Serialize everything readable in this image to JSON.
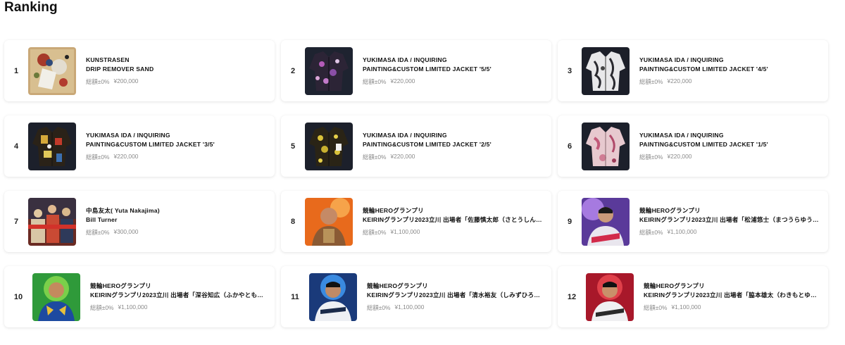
{
  "page": {
    "title": "Ranking"
  },
  "ranking": [
    {
      "rank": "1",
      "artist": "KUNSTRASEN",
      "name": "DRIP REMOVER SAND",
      "change": "総額±0%",
      "price": "¥200,000",
      "thumb": "painting-icon"
    },
    {
      "rank": "2",
      "artist": "YUKIMASA IDA / INQUIRING",
      "name": "PAINTING&CUSTOM LIMITED JACKET '5/5'",
      "change": "総額±0%",
      "price": "¥220,000",
      "thumb": "jacket-icon"
    },
    {
      "rank": "3",
      "artist": "YUKIMASA IDA / INQUIRING",
      "name": "PAINTING&CUSTOM LIMITED JACKET '4/5'",
      "change": "総額±0%",
      "price": "¥220,000",
      "thumb": "jacket-icon"
    },
    {
      "rank": "4",
      "artist": "YUKIMASA IDA / INQUIRING",
      "name": "PAINTING&CUSTOM LIMITED JACKET '3/5'",
      "change": "総額±0%",
      "price": "¥220,000",
      "thumb": "jacket-icon"
    },
    {
      "rank": "5",
      "artist": "YUKIMASA IDA / INQUIRING",
      "name": "PAINTING&CUSTOM LIMITED JACKET '2/5'",
      "change": "総額±0%",
      "price": "¥220,000",
      "thumb": "jacket-icon"
    },
    {
      "rank": "6",
      "artist": "YUKIMASA IDA / INQUIRING",
      "name": "PAINTING&CUSTOM LIMITED JACKET '1/5'",
      "change": "総額±0%",
      "price": "¥220,000",
      "thumb": "jacket-icon"
    },
    {
      "rank": "7",
      "artist": "中島友太( Yuta Nakajima)",
      "name": "Bill Turner",
      "change": "総額±0%",
      "price": "¥300,000",
      "thumb": "painting-icon"
    },
    {
      "rank": "8",
      "artist": "競輪HEROグランプリ",
      "name": "KEIRINグランプリ2023立川 出場者「佐藤慎太郎（さとうしん…",
      "change": "総額±0%",
      "price": "¥1,100,000",
      "thumb": "portrait-icon"
    },
    {
      "rank": "9",
      "artist": "競輪HEROグランプリ",
      "name": "KEIRINグランプリ2023立川 出場者「松浦悠士（まつうらゆう…",
      "change": "総額±0%",
      "price": "¥1,100,000",
      "thumb": "portrait-icon"
    },
    {
      "rank": "10",
      "artist": "競輪HEROグランプリ",
      "name": "KEIRINグランプリ2023立川 出場者「深谷知広（ふかやとも…",
      "change": "総額±0%",
      "price": "¥1,100,000",
      "thumb": "portrait-icon"
    },
    {
      "rank": "11",
      "artist": "競輪HEROグランプリ",
      "name": "KEIRINグランプリ2023立川 出場者「清水裕友（しみずひろ…",
      "change": "総額±0%",
      "price": "¥1,100,000",
      "thumb": "portrait-icon"
    },
    {
      "rank": "12",
      "artist": "競輪HEROグランプリ",
      "name": "KEIRINグランプリ2023立川 出場者「脇本雄太（わきもとゆ…",
      "change": "総額±0%",
      "price": "¥1,100,000",
      "thumb": "portrait-icon"
    }
  ]
}
